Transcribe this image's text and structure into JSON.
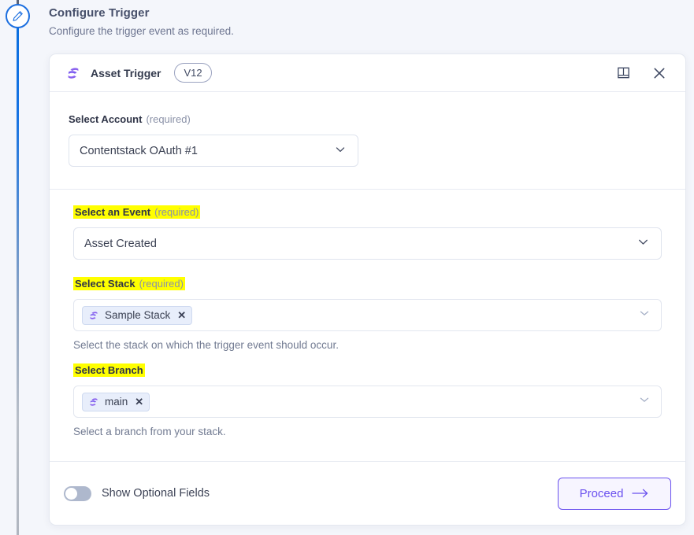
{
  "rail": {
    "node_icon": "pencil-icon",
    "accent_color": "#1c6fe0"
  },
  "page": {
    "title": "Configure Trigger",
    "subtitle": "Configure the trigger event as required."
  },
  "card": {
    "header": {
      "logo_icon": "contentstack-logo-icon",
      "title": "Asset Trigger",
      "version": "V12",
      "doc_icon": "book-icon",
      "close_icon": "close-icon"
    },
    "account": {
      "label": "Select Account",
      "required_text": "(required)",
      "value": "Contentstack OAuth #1",
      "chevron_icon": "chevron-down-icon"
    },
    "event": {
      "label": "Select an Event",
      "required_text": "(required)",
      "value": "Asset Created",
      "chevron_icon": "chevron-down-icon",
      "highlighted": true
    },
    "stack": {
      "label": "Select Stack",
      "required_text": "(required)",
      "chip_label": "Sample Stack",
      "chip_icon": "contentstack-logo-icon",
      "chip_remove_icon": "close-icon",
      "helper": "Select the stack on which the trigger event should occur.",
      "chevron_icon": "chevron-down-icon",
      "highlighted": true
    },
    "branch": {
      "label": "Select Branch",
      "required_text": "",
      "chip_label": "main",
      "chip_icon": "contentstack-logo-icon",
      "chip_remove_icon": "close-icon",
      "helper": "Select a branch from your stack.",
      "chevron_icon": "chevron-down-icon",
      "highlighted": true
    },
    "footer": {
      "toggle_label": "Show Optional Fields",
      "toggle_state": "off",
      "proceed_label": "Proceed",
      "proceed_icon": "arrow-right-icon",
      "proceed_color": "#6a50ef"
    }
  },
  "colors": {
    "page_background": "#f4f6fb",
    "highlight": "#ffff00",
    "brand_purple": "#7c5cf0",
    "rail_blue": "#1c6fe0"
  }
}
